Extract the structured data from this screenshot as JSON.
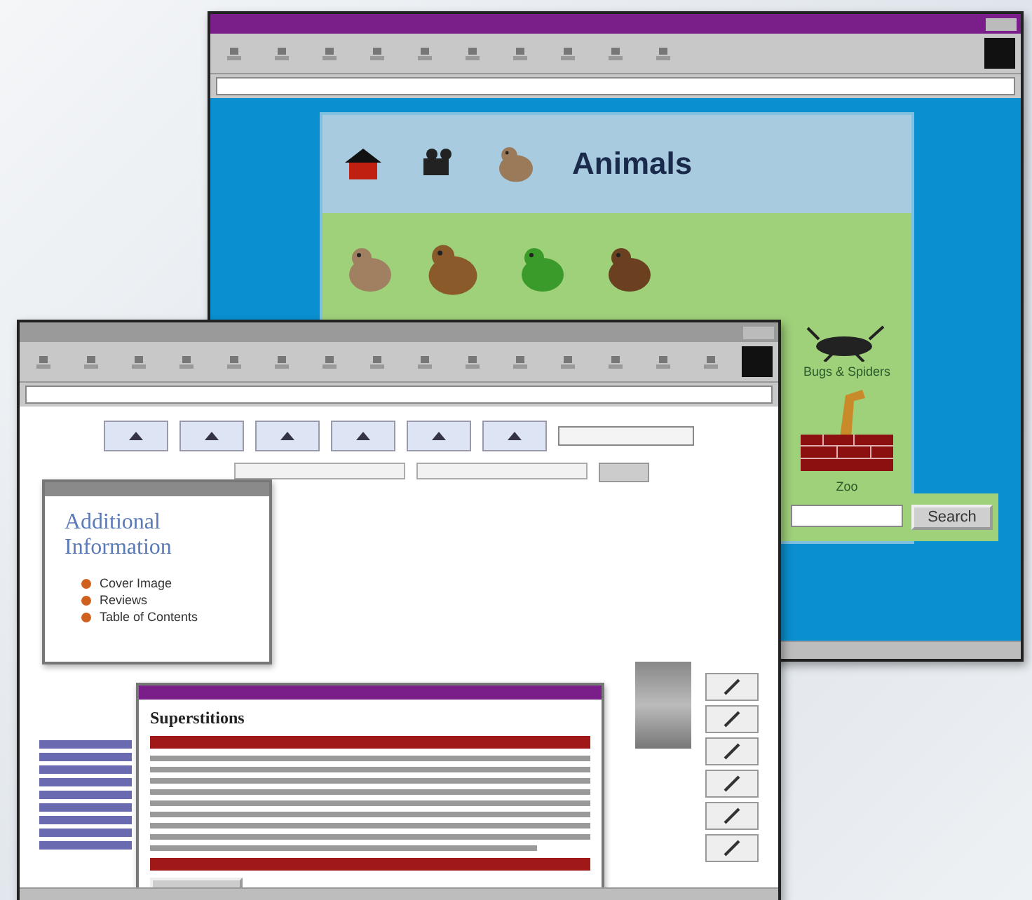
{
  "back_window": {
    "heading": "Animals",
    "tiles": [
      {
        "label": "Bugs & Spiders"
      },
      {
        "label": "Zoo"
      }
    ],
    "search_button": "Search"
  },
  "front_window": {
    "info_popup": {
      "title": "Additional Information",
      "links": [
        "Cover Image",
        "Reviews",
        "Table of Contents"
      ]
    },
    "article_popup": {
      "title": "Superstitions"
    }
  }
}
